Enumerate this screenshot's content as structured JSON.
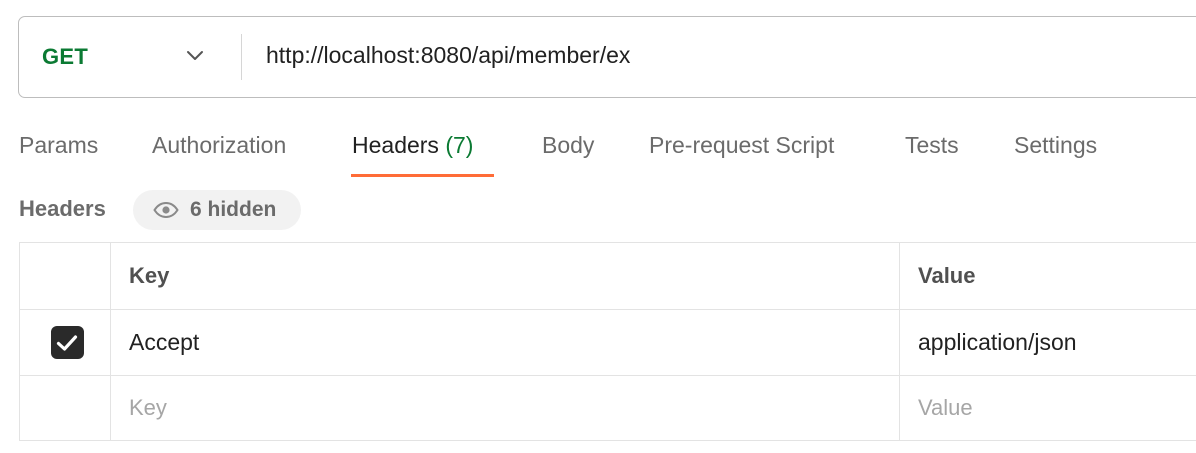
{
  "request": {
    "method": "GET",
    "url": "http://localhost:8080/api/member/ex"
  },
  "tabs": [
    {
      "label": "Params"
    },
    {
      "label": "Authorization"
    },
    {
      "label": "Headers",
      "count": "(7)",
      "active": true
    },
    {
      "label": "Body"
    },
    {
      "label": "Pre-request Script"
    },
    {
      "label": "Tests"
    },
    {
      "label": "Settings"
    }
  ],
  "headers_section": {
    "title": "Headers",
    "hidden_badge": "6 hidden"
  },
  "table": {
    "columns": {
      "key": "Key",
      "value": "Value"
    },
    "rows": [
      {
        "checked": true,
        "key": "Accept",
        "value": "application/json"
      }
    ],
    "new_row": {
      "key_placeholder": "Key",
      "value_placeholder": "Value"
    }
  },
  "colors": {
    "method_get": "#0b7a33",
    "tab_active_underline": "#ff6c37",
    "count_green": "#0b7a33"
  },
  "icons": {
    "method_dropdown": "chevron-down-icon",
    "hidden_badge": "eye-icon",
    "checkbox": "check-icon"
  }
}
